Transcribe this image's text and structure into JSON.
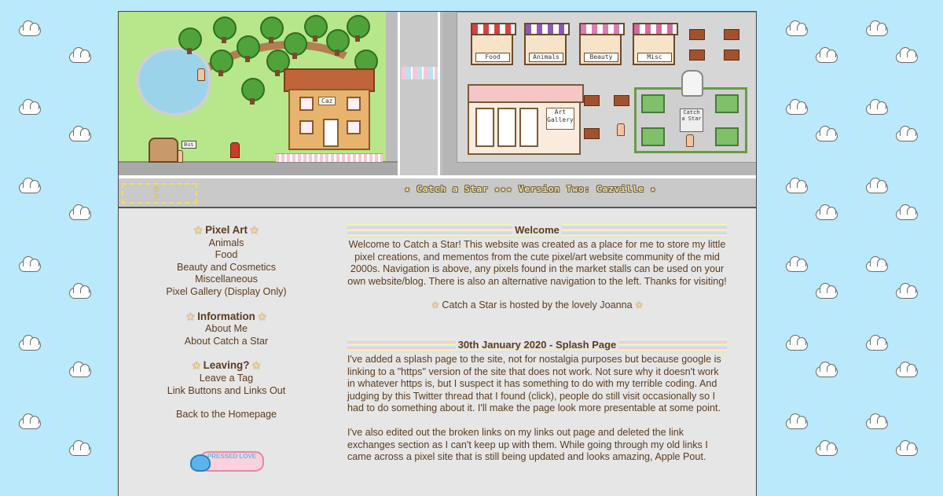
{
  "banner": {
    "caption": "★ Catch a Star ★★★ Version Two: Cazville ★",
    "house_sign": "Caz",
    "bus_sign": "Bus",
    "bus_stop_label": "BUS",
    "stalls": [
      "Food",
      "Animals",
      "Beauty",
      "Misc"
    ],
    "gallery_sign": "Art Gallery",
    "statue_sign": "Catch a Star"
  },
  "sidebar": {
    "groups": [
      {
        "heading": "Pixel Art",
        "links": [
          "Animals",
          "Food",
          "Beauty and Cosmetics",
          "Miscellaneous",
          "Pixel Gallery (Display Only)"
        ]
      },
      {
        "heading": "Information",
        "links": [
          "About Me",
          "About Catch a Star"
        ]
      },
      {
        "heading": "Leaving?",
        "links": [
          "Leave a Tag",
          "Link Buttons and Links Out"
        ]
      }
    ],
    "homepage": "Back to the Homepage",
    "badge_text": "PRESSED LOVE"
  },
  "main": {
    "welcome": {
      "heading": "Welcome",
      "body": "Welcome to Catch a Star! This website was created as a place for me to store my little pixel creations, and mementos from the cute pixel/art website community of the mid 2000s. Navigation is above, any pixels found in the market stalls can be used on your own website/blog. There is also an alternative navigation to the left. Thanks for visiting!",
      "hosted": "Catch a Star is hosted by the lovely Joanna"
    },
    "post": {
      "heading": "30th January 2020 - Splash Page",
      "p1": "I've added a splash page to the site, not for nostalgia purposes but because google is linking to a \"https\" version of the site that does not work. Not sure why it doesn't work in whatever https is, but I suspect it has something to do with my terrible coding. And judging by this Twitter thread that I found (click), people do still visit occasionally so I had to do something about it. I'll make the page look more presentable at some point.",
      "p2": "I've also edited out the broken links on my links out page and deleted the link exchanges section as I can't keep up with them. While going through my old links I came across a pixel site that is still being updated and looks amazing, Apple Pout."
    }
  },
  "colors": {
    "background": "#b9e9fb",
    "panel": "#e6e6e6",
    "text": "#5a3c1e"
  }
}
